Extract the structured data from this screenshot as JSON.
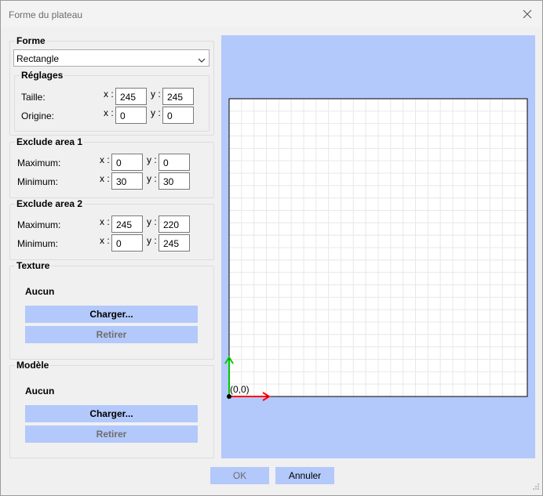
{
  "window": {
    "title": "Forme du plateau"
  },
  "forme": {
    "label": "Forme",
    "shape": "Rectangle",
    "reglages": {
      "label": "Réglages",
      "taille": {
        "label": "Taille:",
        "x": "245",
        "y": "245"
      },
      "origine": {
        "label": "Origine:",
        "x": "0",
        "y": "0"
      }
    }
  },
  "axis_x": "x :",
  "axis_y": "y :",
  "exclude1": {
    "label": "Exclude area 1",
    "maximum": {
      "label": "Maximum:",
      "x": "0",
      "y": "0"
    },
    "minimum": {
      "label": "Minimum:",
      "x": "30",
      "y": "30"
    }
  },
  "exclude2": {
    "label": "Exclude area 2",
    "maximum": {
      "label": "Maximum:",
      "x": "245",
      "y": "220"
    },
    "minimum": {
      "label": "Minimum:",
      "x": "0",
      "y": "245"
    }
  },
  "texture": {
    "label": "Texture",
    "status": "Aucun",
    "load": "Charger...",
    "remove": "Retirer"
  },
  "modele": {
    "label": "Modèle",
    "status": "Aucun",
    "load": "Charger...",
    "remove": "Retirer"
  },
  "preview": {
    "origin_label": "(0,0)",
    "colors": {
      "background": "#b3c8fb",
      "x_axis": "#ff0000",
      "y_axis": "#00c800",
      "grid": "#e8e8e8"
    }
  },
  "footer": {
    "ok": "OK",
    "cancel": "Annuler"
  }
}
